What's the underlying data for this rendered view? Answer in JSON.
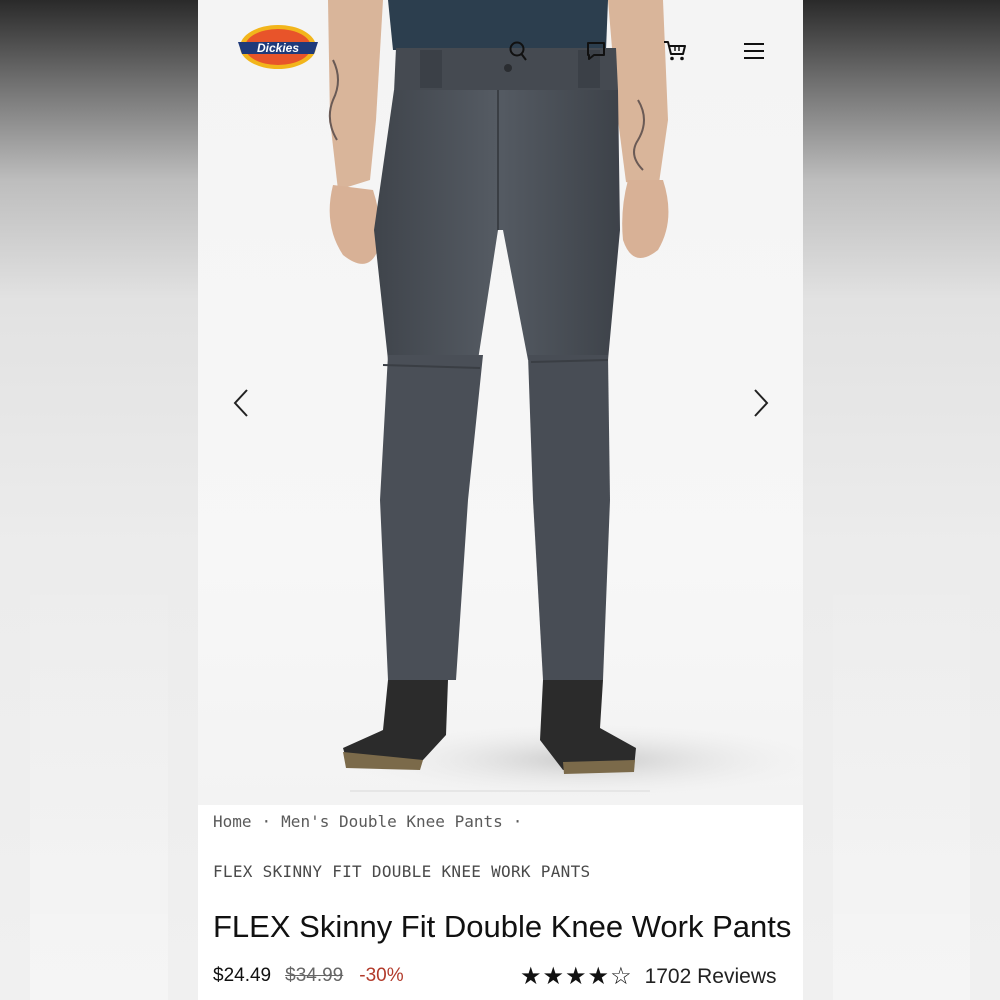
{
  "header": {
    "logo_text": "Dickies"
  },
  "breadcrumb": {
    "items": [
      "Home",
      "Men's Double Knee Pants"
    ],
    "separator": "·"
  },
  "product": {
    "subtitle": "FLEX SKINNY FIT DOUBLE KNEE WORK PANTS",
    "title": "FLEX Skinny Fit Double Knee Work Pants",
    "price": "$24.49",
    "original_price": "$34.99",
    "discount": "-30%",
    "rating_stars": "★★★★☆",
    "rating": 4,
    "rating_max": 5,
    "reviews": "1702 Reviews"
  },
  "icons": {
    "search": "search-icon",
    "chat": "chat-icon",
    "cart": "cart-icon",
    "menu": "menu-icon",
    "prev": "chevron-left-icon",
    "next": "chevron-right-icon"
  },
  "colors": {
    "pants": "#4b5058",
    "discount": "#b23a2a",
    "logo_orange": "#e8542a",
    "logo_navy": "#1f3a7a",
    "logo_yellow": "#f2b51b"
  }
}
